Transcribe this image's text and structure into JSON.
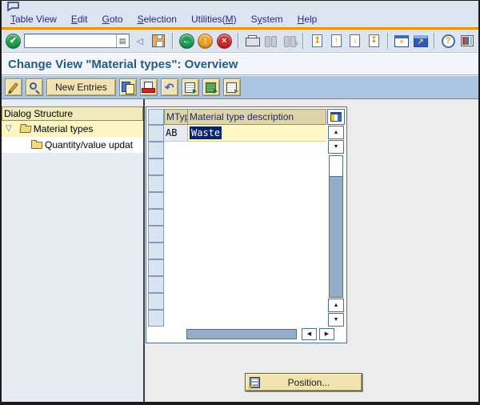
{
  "menu_bar": {
    "items": [
      {
        "label": "Table View",
        "accel": "T"
      },
      {
        "label": "Edit",
        "accel": "E"
      },
      {
        "label": "Goto",
        "accel": "G"
      },
      {
        "label": "Selection",
        "accel": "S"
      },
      {
        "label": "Utilities(M)",
        "accel": "M"
      },
      {
        "label": "System",
        "accel": "y"
      },
      {
        "label": "Help",
        "accel": "H"
      }
    ]
  },
  "toolbar": {
    "command_field": {
      "value": "",
      "placeholder": ""
    }
  },
  "header": {
    "title": "Change View \"Material types\": Overview"
  },
  "app_toolbar": {
    "new_entries_label": "New Entries"
  },
  "dialog_structure": {
    "header": "Dialog Structure",
    "nodes": [
      {
        "label": "Material types",
        "level": 0,
        "expanded": true,
        "selected": true,
        "folder": "open"
      },
      {
        "label": "Quantity/value updat",
        "level": 1,
        "folder": "closed"
      }
    ]
  },
  "table": {
    "columns": [
      {
        "key": "mtyp",
        "label": "MTyp"
      },
      {
        "key": "description",
        "label": "Material type description"
      }
    ],
    "rows": [
      {
        "mtyp": "AB",
        "description": "Waste",
        "description_selected": true
      }
    ],
    "empty_rows": 11
  },
  "position_button": {
    "label": "Position..."
  },
  "icons": {
    "check": "✔",
    "dropdown_list": "▤",
    "collapse": "◁",
    "back_arrow": "←",
    "exit_arrow": "↑",
    "cancel_x": "×",
    "find_plus": "+",
    "page_first": "↥",
    "page_up": "↑",
    "page_down": "↓",
    "page_last": "↧",
    "session_star": "*",
    "shortcut_arrow": "↗",
    "help_q": "?",
    "undo": "↶",
    "tree_expander": "▽",
    "scroll_up": "▲",
    "scroll_down": "▼",
    "scroll_left": "◀",
    "scroll_right": "▶",
    "position_arrow": "↙"
  },
  "colors": {
    "menu_rule_orange": "#f29100",
    "window_bg": "#dce5ef",
    "app_toolbar_blue": "#aac6e3",
    "title_blue": "#235e80",
    "button_beige": "#f0e3b2",
    "table_header_tan": "#ddd4a7",
    "row_yellow": "#fdf8c6",
    "selection_navy": "#0a246a",
    "scrollbar_blue": "#93aec7",
    "tree_highlight_yellow": "#fcf6c5"
  }
}
